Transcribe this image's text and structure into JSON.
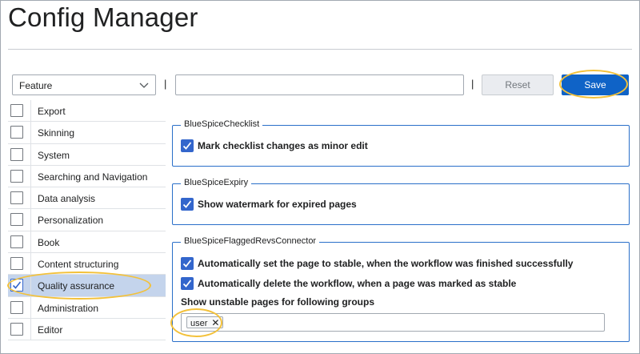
{
  "header": {
    "title": "Config Manager"
  },
  "toolbar": {
    "filter_value": "Feature",
    "separator": "|",
    "search_value": "",
    "reset_label": "Reset",
    "save_label": "Save"
  },
  "sidebar": {
    "items": [
      {
        "label": "Export",
        "checked": false
      },
      {
        "label": "Skinning",
        "checked": false
      },
      {
        "label": "System",
        "checked": false
      },
      {
        "label": "Searching and Navigation",
        "checked": false
      },
      {
        "label": "Data analysis",
        "checked": false
      },
      {
        "label": "Personalization",
        "checked": false
      },
      {
        "label": "Book",
        "checked": false
      },
      {
        "label": "Content structuring",
        "checked": false
      },
      {
        "label": "Quality assurance",
        "checked": true
      },
      {
        "label": "Administration",
        "checked": false
      },
      {
        "label": "Editor",
        "checked": false
      }
    ]
  },
  "sections": {
    "checklist": {
      "legend": "BlueSpiceChecklist",
      "option1": "Mark checklist changes as minor edit"
    },
    "expiry": {
      "legend": "BlueSpiceExpiry",
      "option1": "Show watermark for expired pages"
    },
    "flagged": {
      "legend": "BlueSpiceFlaggedRevsConnector",
      "option1": "Automatically set the page to stable, when the workflow was finished successfully",
      "option2": "Automatically delete the workflow, when a page was marked as stable",
      "groups_label": "Show unstable pages for following groups",
      "tag": "user"
    }
  },
  "colors": {
    "accent": "#3366cc",
    "save": "#0f63c7",
    "highlight": "#f3c13a",
    "selected_row": "#c4d4ec"
  }
}
